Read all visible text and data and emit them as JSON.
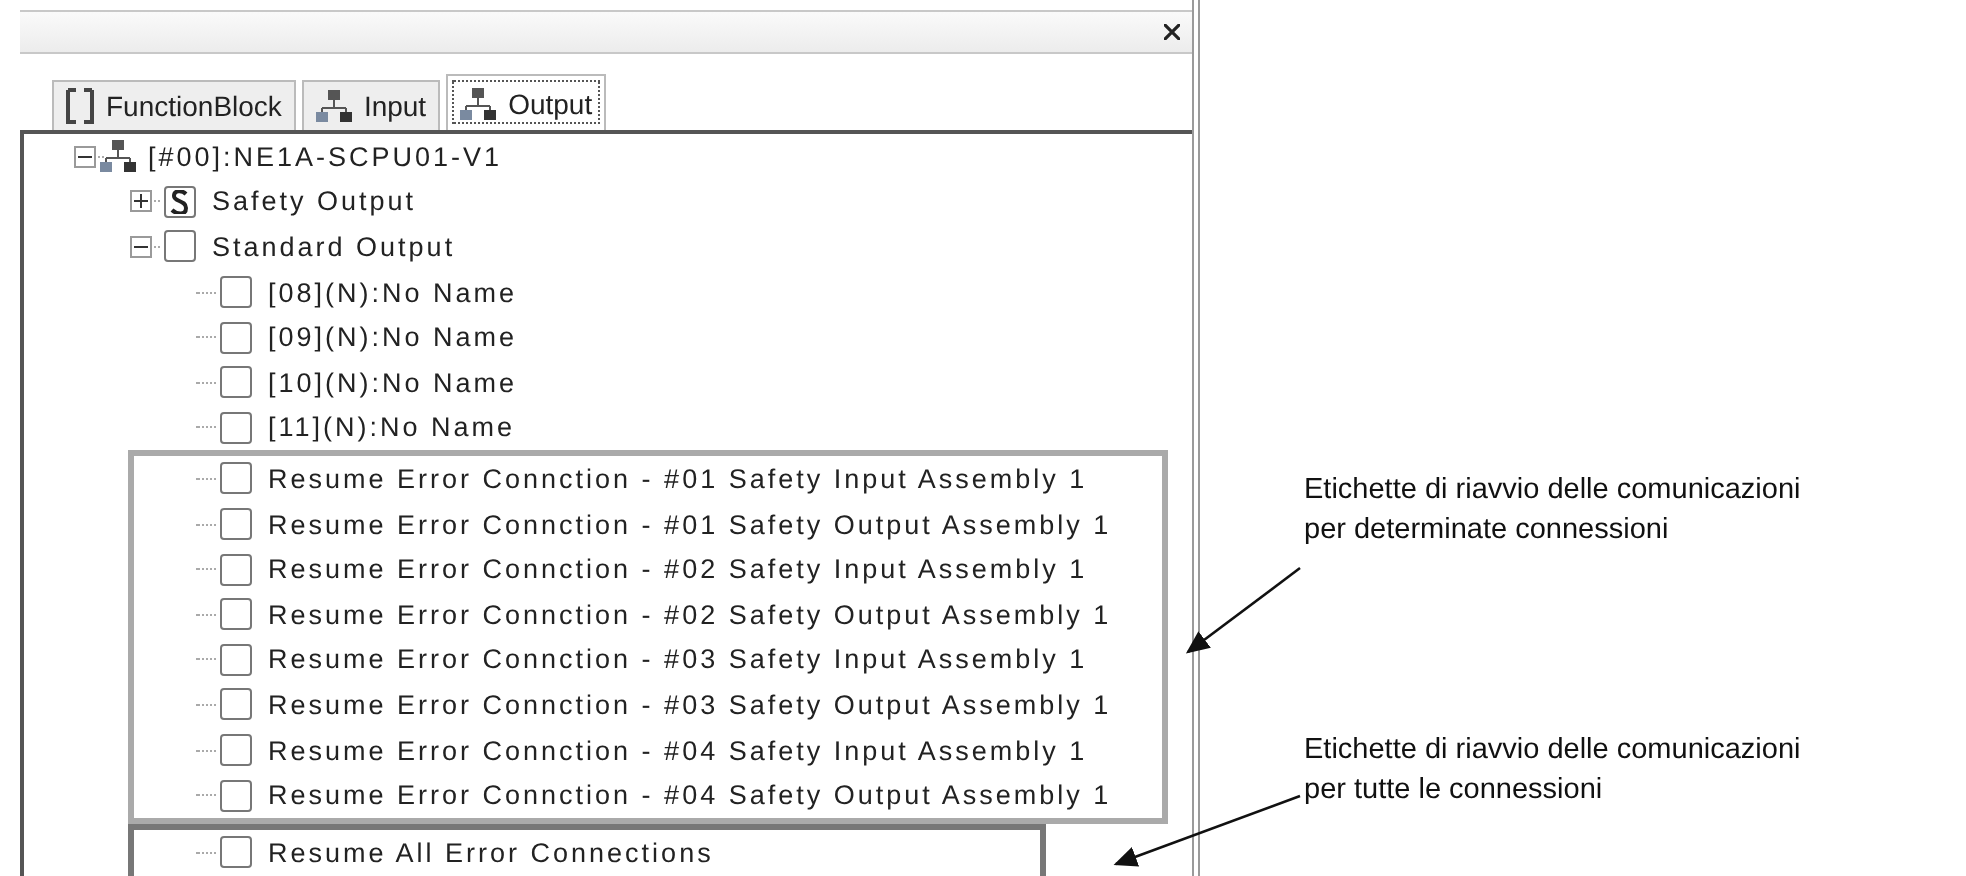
{
  "tabs": [
    {
      "label": "FunctionBlock",
      "kind": "block",
      "selected": false
    },
    {
      "label": "Input",
      "kind": "network",
      "selected": false
    },
    {
      "label": "Output",
      "kind": "network",
      "selected": true
    }
  ],
  "tree": [
    {
      "label": "[#00]:NE1A-SCPU01-V1",
      "kind": "device",
      "expanded": true,
      "children": [
        {
          "label": "Safety Output",
          "kind": "safety",
          "expanded": false
        },
        {
          "label": "Standard Output",
          "kind": "check",
          "checked": false,
          "expanded": true,
          "children": [
            {
              "label": "[08](N):No Name",
              "kind": "check",
              "checked": false
            },
            {
              "label": "[09](N):No Name",
              "kind": "check",
              "checked": false
            },
            {
              "label": "[10](N):No Name",
              "kind": "check",
              "checked": false
            },
            {
              "label": "[11](N):No Name",
              "kind": "check",
              "checked": false
            },
            {
              "kind": "group",
              "emphasis": false,
              "children": [
                {
                  "label": "Resume Error Connction - #01 Safety Input Assembly 1",
                  "kind": "check",
                  "checked": false
                },
                {
                  "label": "Resume Error Connction - #01 Safety Output Assembly 1",
                  "kind": "check",
                  "checked": false
                },
                {
                  "label": "Resume Error Connction - #02 Safety Input Assembly 1",
                  "kind": "check",
                  "checked": false
                },
                {
                  "label": "Resume Error Connction - #02 Safety Output Assembly 1",
                  "kind": "check",
                  "checked": false
                },
                {
                  "label": "Resume Error Connction - #03 Safety Input Assembly 1",
                  "kind": "check",
                  "checked": false
                },
                {
                  "label": "Resume Error Connction - #03 Safety Output Assembly 1",
                  "kind": "check",
                  "checked": false
                },
                {
                  "label": "Resume Error Connction - #04 Safety Input Assembly 1",
                  "kind": "check",
                  "checked": false
                },
                {
                  "label": "Resume Error Connction - #04 Safety Output Assembly 1",
                  "kind": "check",
                  "checked": false
                }
              ]
            },
            {
              "kind": "group",
              "emphasis": true,
              "children": [
                {
                  "label": "Resume All Error Connections",
                  "kind": "check",
                  "checked": false
                }
              ]
            }
          ]
        }
      ]
    }
  ],
  "callouts": [
    {
      "lines": [
        "Etichette di riavvio delle comunicazioni",
        "per determinate connessioni"
      ]
    },
    {
      "lines": [
        "Etichette di riavvio delle comunicazioni",
        "per tutte le connessioni"
      ]
    }
  ]
}
